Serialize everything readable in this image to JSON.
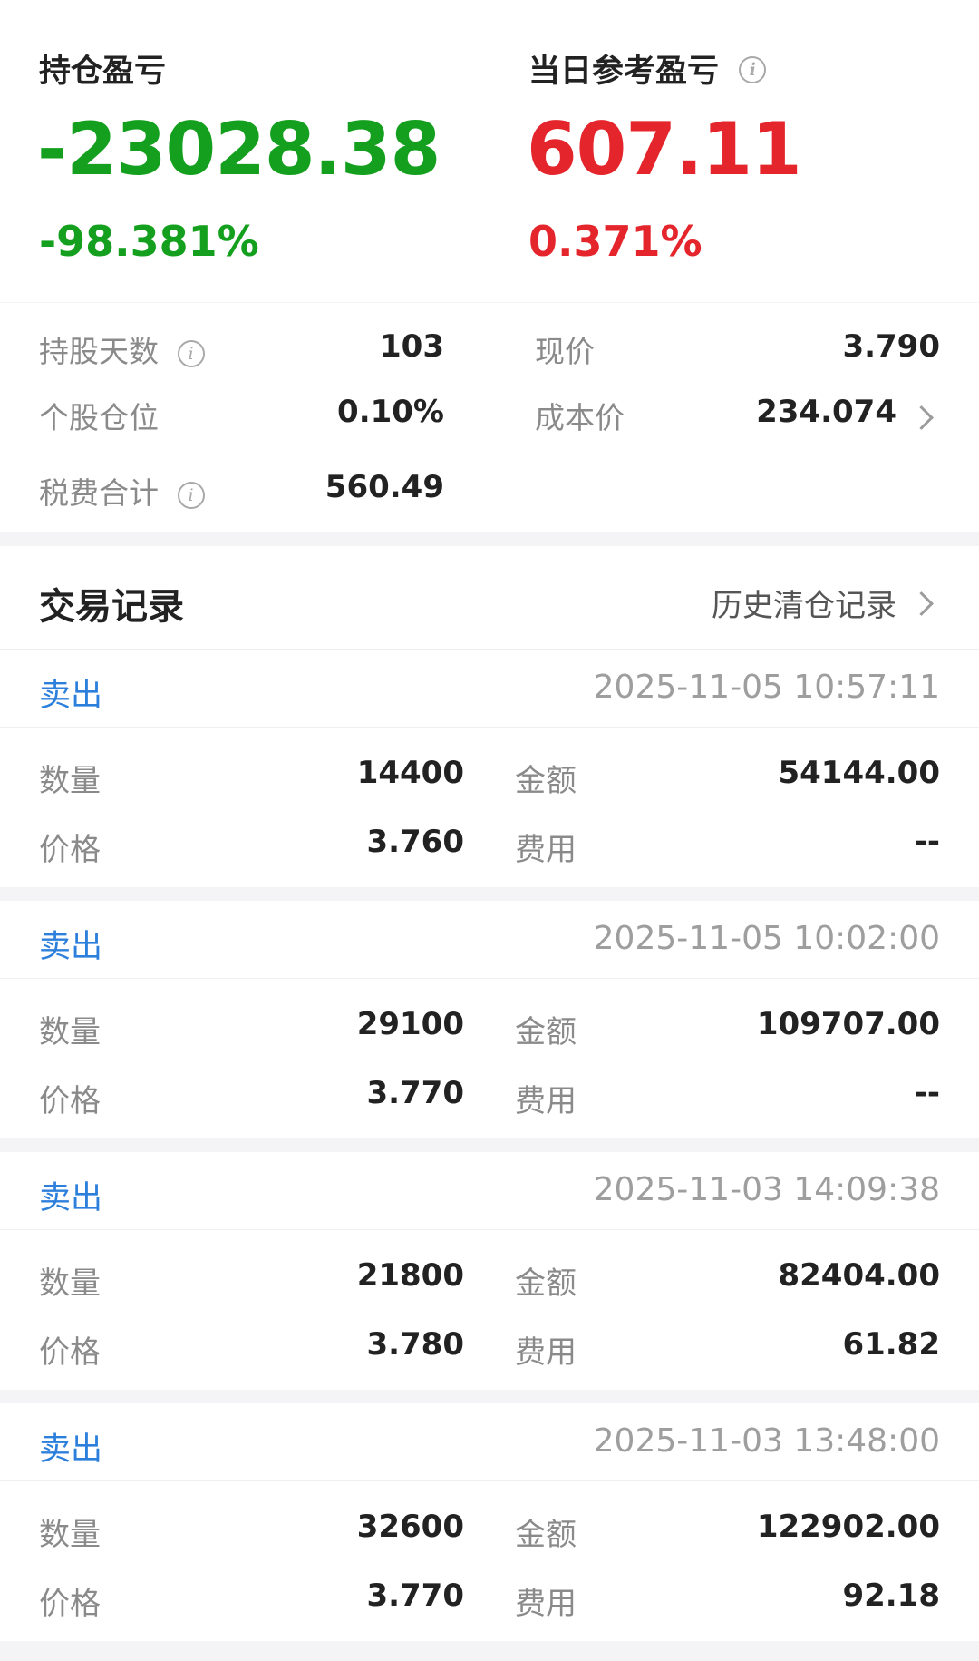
{
  "summary": {
    "left": {
      "label": "持仓盈亏",
      "value": "-23028.38",
      "pct": "-98.381%"
    },
    "right": {
      "label": "当日参考盈亏",
      "value": "607.11",
      "pct": "0.371%"
    }
  },
  "metrics": {
    "hold_days": {
      "label": "持股天数",
      "value": "103"
    },
    "current_price": {
      "label": "现价",
      "value": "3.790"
    },
    "position_ratio": {
      "label": "个股仓位",
      "value": "0.10%"
    },
    "cost_price": {
      "label": "成本价",
      "value": "234.074"
    },
    "tax_total": {
      "label": "税费合计",
      "value": "560.49"
    }
  },
  "records_header": {
    "title": "交易记录",
    "history_link": "历史清仓记录"
  },
  "record_labels": {
    "qty": "数量",
    "amount": "金额",
    "price": "价格",
    "fee": "费用"
  },
  "records": [
    {
      "type": "卖出",
      "time": "2025-11-05 10:57:11",
      "qty": "14400",
      "amount": "54144.00",
      "price": "3.760",
      "fee": "--"
    },
    {
      "type": "卖出",
      "time": "2025-11-05 10:02:00",
      "qty": "29100",
      "amount": "109707.00",
      "price": "3.770",
      "fee": "--"
    },
    {
      "type": "卖出",
      "time": "2025-11-03 14:09:38",
      "qty": "21800",
      "amount": "82404.00",
      "price": "3.780",
      "fee": "61.82"
    },
    {
      "type": "卖出",
      "time": "2025-11-03 13:48:00",
      "qty": "32600",
      "amount": "122902.00",
      "price": "3.770",
      "fee": "92.18"
    }
  ],
  "colors": {
    "loss_green": "#14a01e",
    "gain_red": "#e4252c",
    "link_blue": "#2d7fdc"
  },
  "icons": [
    "info-icon",
    "chevron-right-icon"
  ]
}
